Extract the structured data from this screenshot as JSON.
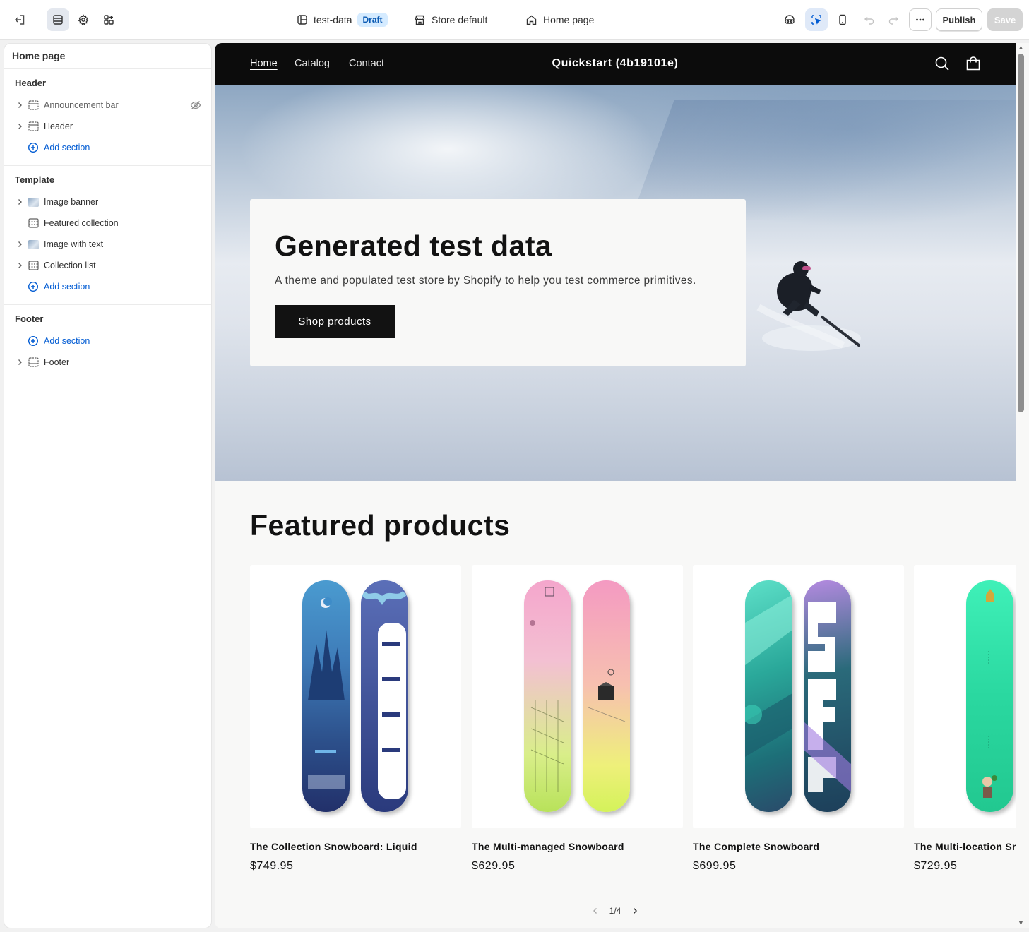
{
  "topbar": {
    "theme_name": "test-data",
    "theme_status": "Draft",
    "store_context": "Store default",
    "page_selector": "Home page",
    "publish_label": "Publish",
    "save_label": "Save"
  },
  "sidebar": {
    "title": "Home page",
    "groups": [
      {
        "title": "Header",
        "items": [
          {
            "label": "Announcement bar",
            "hidden": true
          },
          {
            "label": "Header"
          }
        ],
        "add_label": "Add section"
      },
      {
        "title": "Template",
        "items": [
          {
            "label": "Image banner"
          },
          {
            "label": "Featured collection"
          },
          {
            "label": "Image with text"
          },
          {
            "label": "Collection list"
          }
        ],
        "add_label": "Add section"
      },
      {
        "title": "Footer",
        "add_label": "Add section",
        "items": [
          {
            "label": "Footer"
          }
        ]
      }
    ]
  },
  "store": {
    "nav": [
      "Home",
      "Catalog",
      "Contact"
    ],
    "title": "Quickstart (4b19101e)",
    "hero": {
      "heading": "Generated test data",
      "text": "A theme and populated test store by Shopify to help you test commerce primitives.",
      "button": "Shop products"
    },
    "featured": {
      "heading": "Featured products",
      "products": [
        {
          "name": "The Collection Snowboard: Liquid",
          "price": "$749.95"
        },
        {
          "name": "The Multi-managed Snowboard",
          "price": "$629.95"
        },
        {
          "name": "The Complete Snowboard",
          "price": "$699.95"
        },
        {
          "name": "The Multi-location Sn",
          "price": "$729.95"
        }
      ],
      "pagination": "1/4"
    }
  },
  "colors": {
    "accent_blue": "#005bd3",
    "draft_badge_bg": "#d5ebff",
    "store_nav_bg": "#0c0c0c",
    "button_dark": "#121212"
  }
}
